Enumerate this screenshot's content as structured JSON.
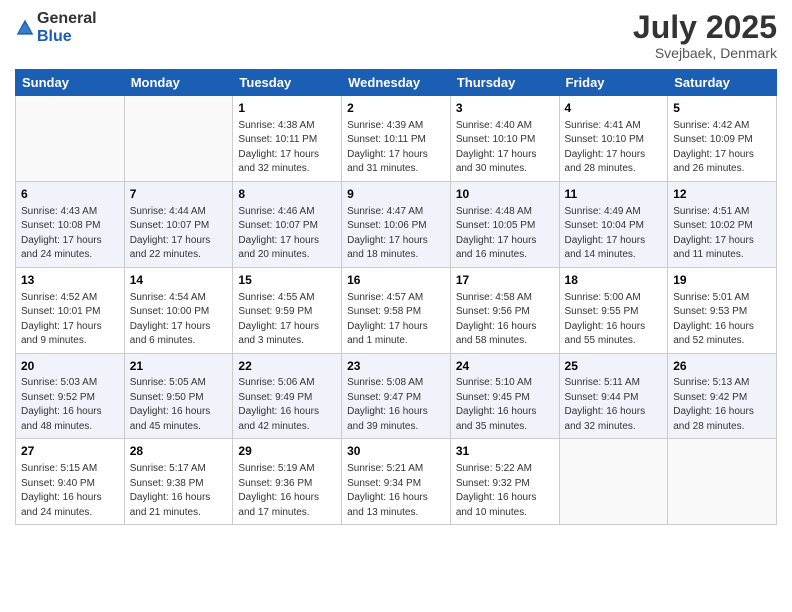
{
  "logo": {
    "general": "General",
    "blue": "Blue"
  },
  "title": "July 2025",
  "subtitle": "Svejbaek, Denmark",
  "headers": [
    "Sunday",
    "Monday",
    "Tuesday",
    "Wednesday",
    "Thursday",
    "Friday",
    "Saturday"
  ],
  "weeks": [
    [
      {
        "day": "",
        "info": ""
      },
      {
        "day": "",
        "info": ""
      },
      {
        "day": "1",
        "info": "Sunrise: 4:38 AM\nSunset: 10:11 PM\nDaylight: 17 hours\nand 32 minutes."
      },
      {
        "day": "2",
        "info": "Sunrise: 4:39 AM\nSunset: 10:11 PM\nDaylight: 17 hours\nand 31 minutes."
      },
      {
        "day": "3",
        "info": "Sunrise: 4:40 AM\nSunset: 10:10 PM\nDaylight: 17 hours\nand 30 minutes."
      },
      {
        "day": "4",
        "info": "Sunrise: 4:41 AM\nSunset: 10:10 PM\nDaylight: 17 hours\nand 28 minutes."
      },
      {
        "day": "5",
        "info": "Sunrise: 4:42 AM\nSunset: 10:09 PM\nDaylight: 17 hours\nand 26 minutes."
      }
    ],
    [
      {
        "day": "6",
        "info": "Sunrise: 4:43 AM\nSunset: 10:08 PM\nDaylight: 17 hours\nand 24 minutes."
      },
      {
        "day": "7",
        "info": "Sunrise: 4:44 AM\nSunset: 10:07 PM\nDaylight: 17 hours\nand 22 minutes."
      },
      {
        "day": "8",
        "info": "Sunrise: 4:46 AM\nSunset: 10:07 PM\nDaylight: 17 hours\nand 20 minutes."
      },
      {
        "day": "9",
        "info": "Sunrise: 4:47 AM\nSunset: 10:06 PM\nDaylight: 17 hours\nand 18 minutes."
      },
      {
        "day": "10",
        "info": "Sunrise: 4:48 AM\nSunset: 10:05 PM\nDaylight: 17 hours\nand 16 minutes."
      },
      {
        "day": "11",
        "info": "Sunrise: 4:49 AM\nSunset: 10:04 PM\nDaylight: 17 hours\nand 14 minutes."
      },
      {
        "day": "12",
        "info": "Sunrise: 4:51 AM\nSunset: 10:02 PM\nDaylight: 17 hours\nand 11 minutes."
      }
    ],
    [
      {
        "day": "13",
        "info": "Sunrise: 4:52 AM\nSunset: 10:01 PM\nDaylight: 17 hours\nand 9 minutes."
      },
      {
        "day": "14",
        "info": "Sunrise: 4:54 AM\nSunset: 10:00 PM\nDaylight: 17 hours\nand 6 minutes."
      },
      {
        "day": "15",
        "info": "Sunrise: 4:55 AM\nSunset: 9:59 PM\nDaylight: 17 hours\nand 3 minutes."
      },
      {
        "day": "16",
        "info": "Sunrise: 4:57 AM\nSunset: 9:58 PM\nDaylight: 17 hours\nand 1 minute."
      },
      {
        "day": "17",
        "info": "Sunrise: 4:58 AM\nSunset: 9:56 PM\nDaylight: 16 hours\nand 58 minutes."
      },
      {
        "day": "18",
        "info": "Sunrise: 5:00 AM\nSunset: 9:55 PM\nDaylight: 16 hours\nand 55 minutes."
      },
      {
        "day": "19",
        "info": "Sunrise: 5:01 AM\nSunset: 9:53 PM\nDaylight: 16 hours\nand 52 minutes."
      }
    ],
    [
      {
        "day": "20",
        "info": "Sunrise: 5:03 AM\nSunset: 9:52 PM\nDaylight: 16 hours\nand 48 minutes."
      },
      {
        "day": "21",
        "info": "Sunrise: 5:05 AM\nSunset: 9:50 PM\nDaylight: 16 hours\nand 45 minutes."
      },
      {
        "day": "22",
        "info": "Sunrise: 5:06 AM\nSunset: 9:49 PM\nDaylight: 16 hours\nand 42 minutes."
      },
      {
        "day": "23",
        "info": "Sunrise: 5:08 AM\nSunset: 9:47 PM\nDaylight: 16 hours\nand 39 minutes."
      },
      {
        "day": "24",
        "info": "Sunrise: 5:10 AM\nSunset: 9:45 PM\nDaylight: 16 hours\nand 35 minutes."
      },
      {
        "day": "25",
        "info": "Sunrise: 5:11 AM\nSunset: 9:44 PM\nDaylight: 16 hours\nand 32 minutes."
      },
      {
        "day": "26",
        "info": "Sunrise: 5:13 AM\nSunset: 9:42 PM\nDaylight: 16 hours\nand 28 minutes."
      }
    ],
    [
      {
        "day": "27",
        "info": "Sunrise: 5:15 AM\nSunset: 9:40 PM\nDaylight: 16 hours\nand 24 minutes."
      },
      {
        "day": "28",
        "info": "Sunrise: 5:17 AM\nSunset: 9:38 PM\nDaylight: 16 hours\nand 21 minutes."
      },
      {
        "day": "29",
        "info": "Sunrise: 5:19 AM\nSunset: 9:36 PM\nDaylight: 16 hours\nand 17 minutes."
      },
      {
        "day": "30",
        "info": "Sunrise: 5:21 AM\nSunset: 9:34 PM\nDaylight: 16 hours\nand 13 minutes."
      },
      {
        "day": "31",
        "info": "Sunrise: 5:22 AM\nSunset: 9:32 PM\nDaylight: 16 hours\nand 10 minutes."
      },
      {
        "day": "",
        "info": ""
      },
      {
        "day": "",
        "info": ""
      }
    ]
  ]
}
